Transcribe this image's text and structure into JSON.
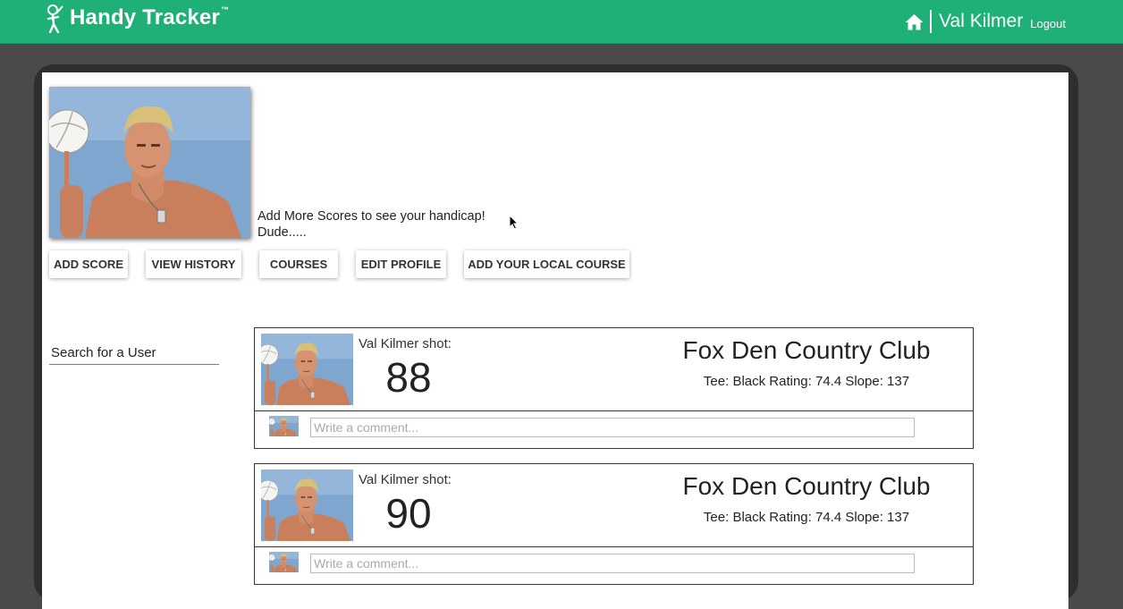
{
  "header": {
    "brand": "Handy Tracker",
    "brand_tm": "™",
    "user_name": "Val Kilmer",
    "logout_label": "Logout",
    "accent_color": "#1fb077"
  },
  "profile": {
    "handicap_message": "Add More Scores to see your handicap!",
    "tagline": "Dude....."
  },
  "actions": [
    {
      "label": "ADD SCORE"
    },
    {
      "label": "VIEW HISTORY"
    },
    {
      "label": "COURSES"
    },
    {
      "label": "EDIT PROFILE"
    },
    {
      "label": "ADD YOUR LOCAL COURSE"
    }
  ],
  "search": {
    "placeholder": "Search for a User"
  },
  "feed": [
    {
      "shot_label": "Val Kilmer shot:",
      "score": "88",
      "course": "Fox Den Country Club",
      "tee_info": "Tee: Black Rating: 74.4 Slope: 137",
      "comment_placeholder": "Write a comment..."
    },
    {
      "shot_label": "Val Kilmer shot:",
      "score": "90",
      "course": "Fox Den Country Club",
      "tee_info": "Tee: Black Rating: 74.4 Slope: 137",
      "comment_placeholder": "Write a comment..."
    }
  ]
}
